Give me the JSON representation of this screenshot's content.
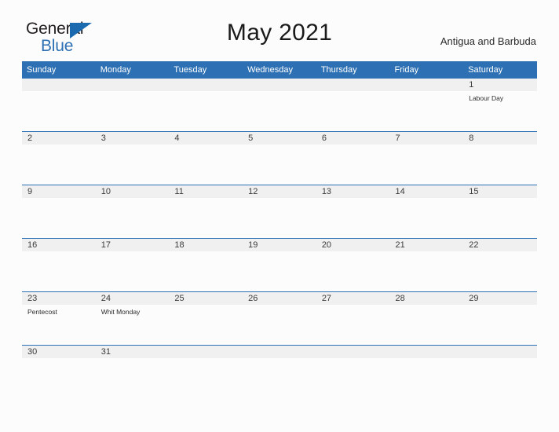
{
  "brand": {
    "name_part1": "General",
    "name_part2": "Blue",
    "triangle_icon": "brand-triangle-icon",
    "accent_color": "#2d70b3"
  },
  "header": {
    "title": "May 2021",
    "country": "Antigua and Barbuda"
  },
  "calendar": {
    "month": "May",
    "year": "2021",
    "weekday_headers": [
      "Sunday",
      "Monday",
      "Tuesday",
      "Wednesday",
      "Thursday",
      "Friday",
      "Saturday"
    ],
    "header_bg": "#2d70b3",
    "daynum_bg": "#f0f0f0",
    "weeks": [
      [
        {
          "day": "",
          "holiday": ""
        },
        {
          "day": "",
          "holiday": ""
        },
        {
          "day": "",
          "holiday": ""
        },
        {
          "day": "",
          "holiday": ""
        },
        {
          "day": "",
          "holiday": ""
        },
        {
          "day": "",
          "holiday": ""
        },
        {
          "day": "1",
          "holiday": "Labour Day"
        }
      ],
      [
        {
          "day": "2",
          "holiday": ""
        },
        {
          "day": "3",
          "holiday": ""
        },
        {
          "day": "4",
          "holiday": ""
        },
        {
          "day": "5",
          "holiday": ""
        },
        {
          "day": "6",
          "holiday": ""
        },
        {
          "day": "7",
          "holiday": ""
        },
        {
          "day": "8",
          "holiday": ""
        }
      ],
      [
        {
          "day": "9",
          "holiday": ""
        },
        {
          "day": "10",
          "holiday": ""
        },
        {
          "day": "11",
          "holiday": ""
        },
        {
          "day": "12",
          "holiday": ""
        },
        {
          "day": "13",
          "holiday": ""
        },
        {
          "day": "14",
          "holiday": ""
        },
        {
          "day": "15",
          "holiday": ""
        }
      ],
      [
        {
          "day": "16",
          "holiday": ""
        },
        {
          "day": "17",
          "holiday": ""
        },
        {
          "day": "18",
          "holiday": ""
        },
        {
          "day": "19",
          "holiday": ""
        },
        {
          "day": "20",
          "holiday": ""
        },
        {
          "day": "21",
          "holiday": ""
        },
        {
          "day": "22",
          "holiday": ""
        }
      ],
      [
        {
          "day": "23",
          "holiday": "Pentecost"
        },
        {
          "day": "24",
          "holiday": "Whit Monday"
        },
        {
          "day": "25",
          "holiday": ""
        },
        {
          "day": "26",
          "holiday": ""
        },
        {
          "day": "27",
          "holiday": ""
        },
        {
          "day": "28",
          "holiday": ""
        },
        {
          "day": "29",
          "holiday": ""
        }
      ],
      [
        {
          "day": "30",
          "holiday": ""
        },
        {
          "day": "31",
          "holiday": ""
        },
        {
          "day": "",
          "holiday": ""
        },
        {
          "day": "",
          "holiday": ""
        },
        {
          "day": "",
          "holiday": ""
        },
        {
          "day": "",
          "holiday": ""
        },
        {
          "day": "",
          "holiday": ""
        }
      ]
    ]
  }
}
